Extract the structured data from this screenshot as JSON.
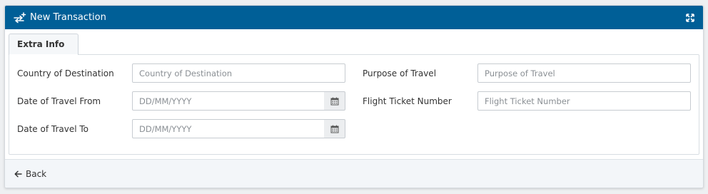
{
  "header": {
    "title": "New Transaction",
    "icon": "transfer-plus-icon",
    "expand_icon": "expand-icon",
    "color": "#005f97"
  },
  "tabs": [
    {
      "label": "Extra Info",
      "active": true
    }
  ],
  "fields": {
    "country_of_destination": {
      "label": "Country of Destination",
      "placeholder": "Country of Destination",
      "value": ""
    },
    "purpose_of_travel": {
      "label": "Purpose of Travel",
      "placeholder": "Purpose of Travel",
      "value": ""
    },
    "date_from": {
      "label": "Date of Travel From",
      "placeholder": "DD/MM/YYYY",
      "value": "",
      "icon": "calendar-icon"
    },
    "flight_ticket_number": {
      "label": "Flight Ticket Number",
      "placeholder": "Flight Ticket Number",
      "value": ""
    },
    "date_to": {
      "label": "Date of Travel To",
      "placeholder": "DD/MM/YYYY",
      "value": "",
      "icon": "calendar-icon"
    }
  },
  "footer": {
    "back_label": "Back",
    "back_icon": "arrow-left-icon"
  }
}
